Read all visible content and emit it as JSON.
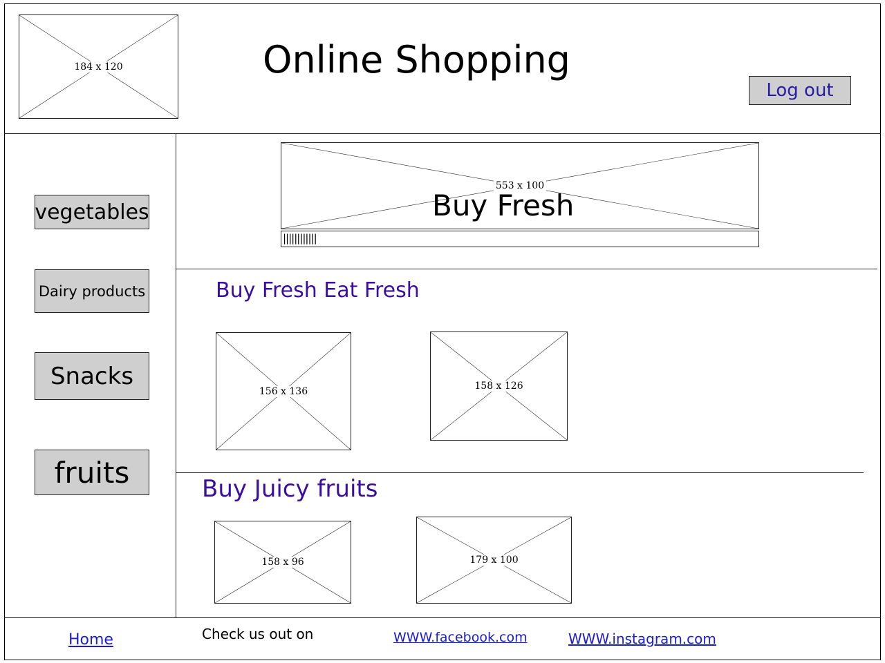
{
  "header": {
    "logo_placeholder": "184 x 120",
    "title": "Online Shopping",
    "logout_label": "Log out"
  },
  "sidebar": {
    "items": [
      {
        "label": "vegetables"
      },
      {
        "label": "Dairy products"
      },
      {
        "label": "Snacks"
      },
      {
        "label": "fruits"
      }
    ]
  },
  "banner": {
    "placeholder": "553 x 100",
    "title": "Buy Fresh",
    "scroll_ticks": "||||||||||||"
  },
  "sections": [
    {
      "heading": "Buy Fresh Eat Fresh",
      "images": [
        "156 x 136",
        "158 x 126"
      ]
    },
    {
      "heading": "Buy Juicy fruits",
      "images": [
        "158 x 96",
        "179 x 100"
      ]
    }
  ],
  "footer": {
    "home_label": "Home",
    "check_text": "Check us out on",
    "facebook_label": "WWW.facebook.com",
    "instagram_label": "WWW.instagram.com"
  }
}
